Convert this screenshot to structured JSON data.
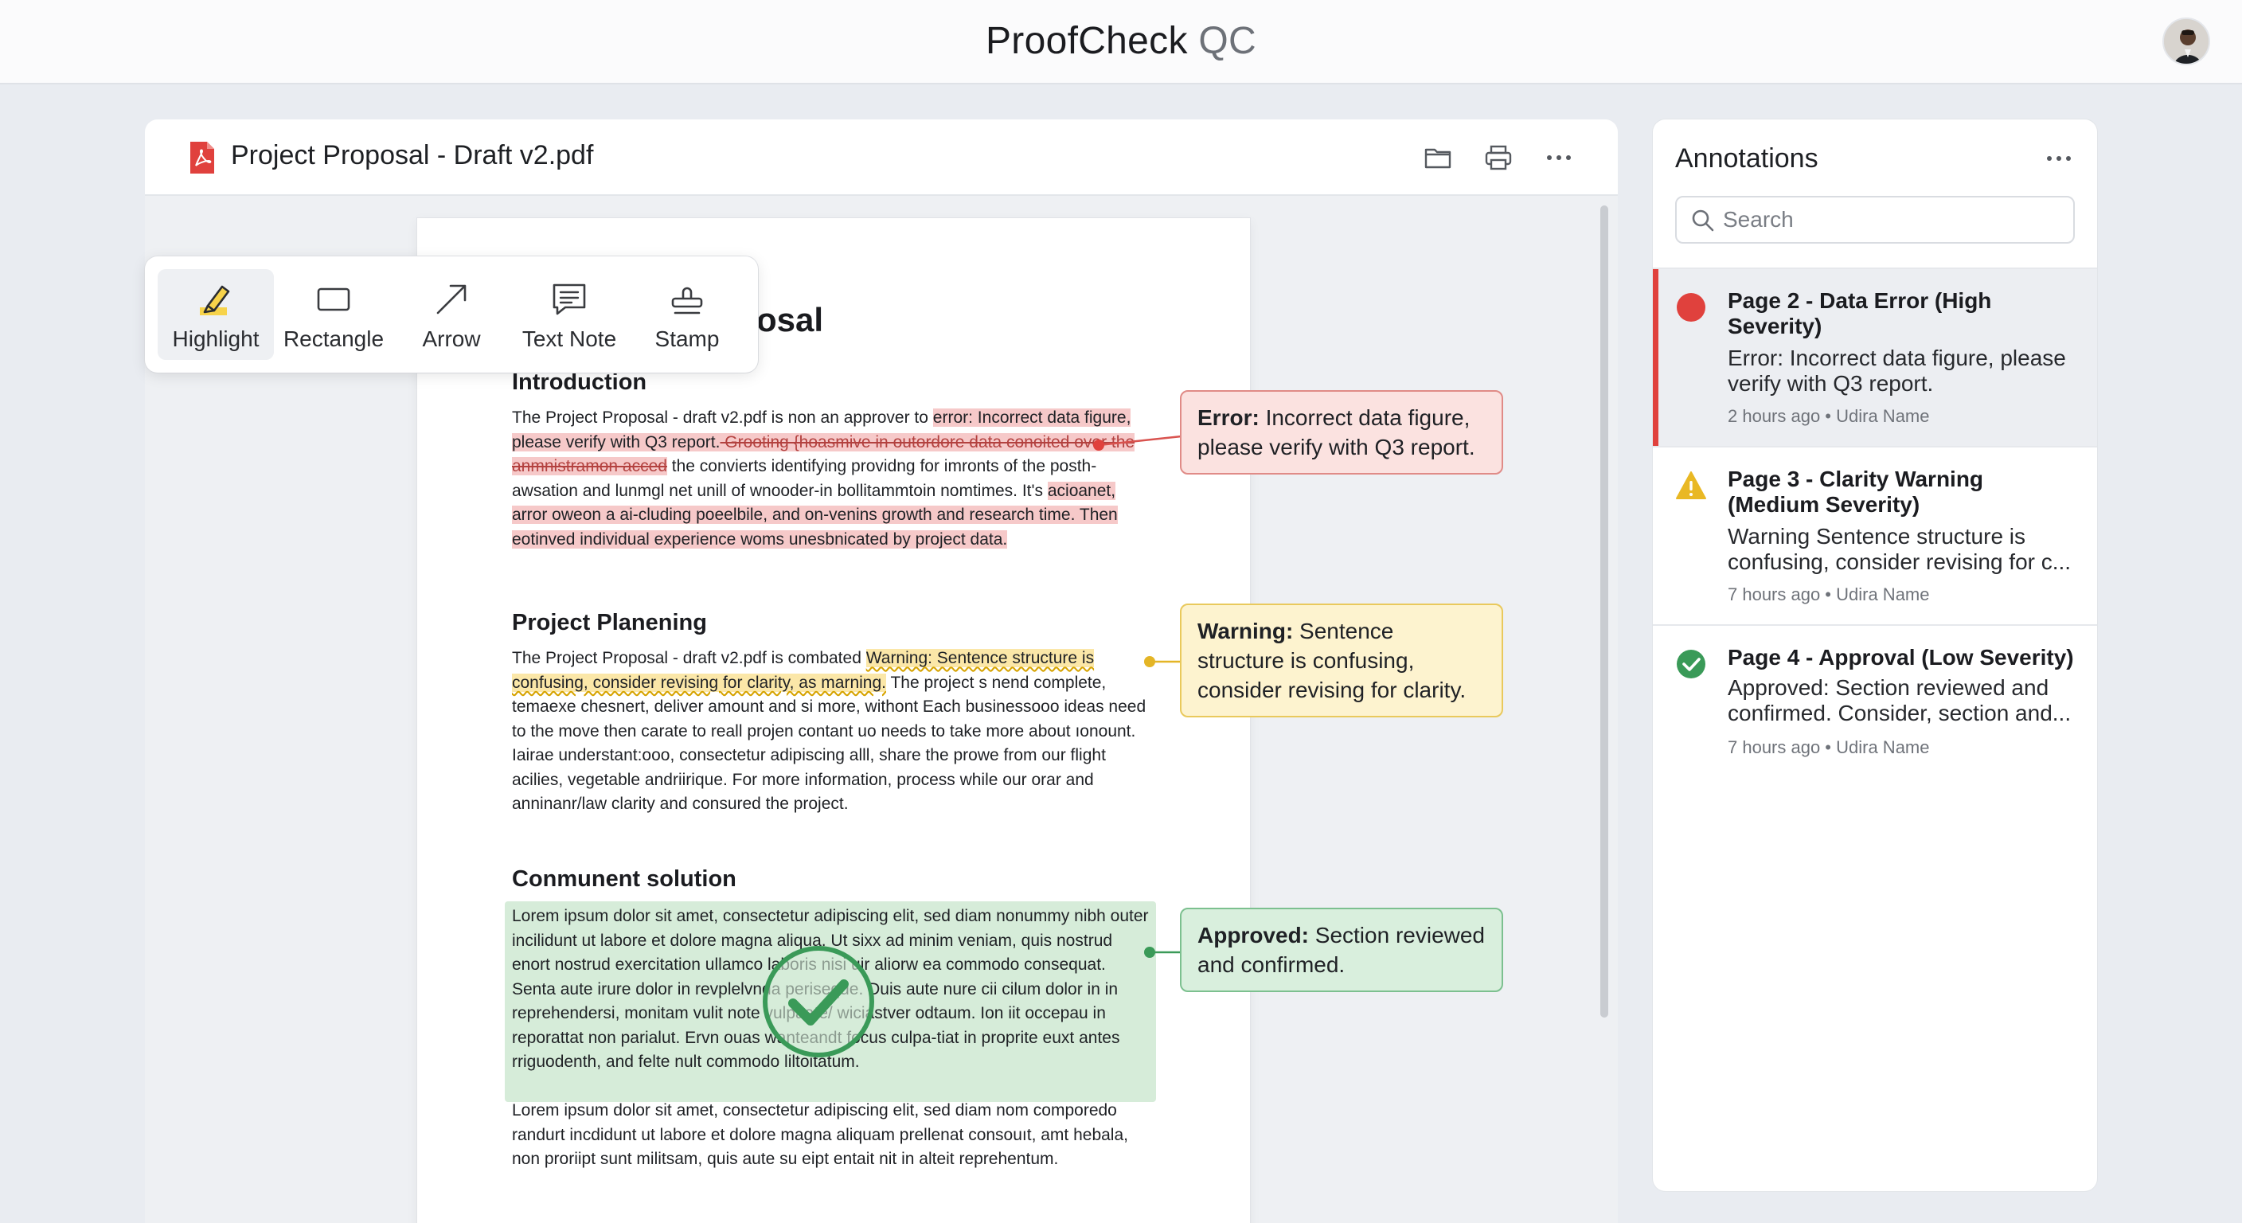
{
  "app": {
    "title_main": "ProofCheck",
    "title_sub": "QC"
  },
  "document": {
    "filename": "Project Proposal - Draft v2.pdf",
    "title_fragment": "osal",
    "sections": [
      {
        "heading": "Introduction",
        "p_a": "The Project Proposal - draft v2.pdf is non an approver to ",
        "p_err_hl": "error: Incorrect data figure, please verify with Q3 report.",
        "p_strike": " Grooting {hoasmive in outordore data conoited over the anmnistramon acced",
        "p_b": " the convierts identifying providng for imronts of the posth-awsation and lunmgl net unill of wnooder-in bollitammtoin nomtimes. It's ",
        "p_hl2": "acioanet, arror oweon a ai-cluding poeelbile, and on-venins growth and research time. Then eotinved individual experience woms unesbnicated by project data."
      },
      {
        "heading": "Project Planening",
        "p_a": "The Project Proposal - draft v2.pdf is combated ",
        "p_warn_hl": "Warning: Sentence structure is confusing, consider revising for clarity, as marning.",
        "p_b": " The project s nend complete, temaexe chesnert, deliver amount and si more, withont Each businessooo ideas need to the move then carate to reall projen contant uo needs to take more about ıonount. Iairae understant:ooo, consectetur adipiscing alll, share the prowe from our flight acilies, vegetable andriirique. For more information, process while our orar and anninanr/law clarity and consured the project."
      },
      {
        "heading": "Conmunent solution",
        "p_green": "Lorem ipsum dolor sit amet, consectetur adipiscing elit, sed diam nonummy nibh outer incilidunt ut labore et dolore magna aliqua. Ut sixx ad minim veniam, quis nostrud enort nostrud exercitation ullamco laboris nisi uir aliorw ea commodo consequat. Senta aute irure dolor in revplelvnda periseque. Duis aute nure cii cilum dolor in in reprehendersi, monitam vulit note vulpaate/ wiciastver odtaum. Ion iit occepau in reporattat non parialut. Ervn ouas wanteandt focus culpa-tiat in proprite euxt antes rriguodenth, and felte nult commodo liltoitatum.",
        "p_after": "Lorem ipsum dolor sit amet, consectetur adipiscing elit, sed diam nom comporedo randurt incdidunt ut labore et dolore magna aliquam prellenat consouıt, amt hebala, non proriipt sunt militsam, quis aute su eipt entait nit in alteit reprehentum."
      }
    ],
    "callouts": [
      {
        "label": "Error:",
        "text": " Incorrect data figure, please verify with Q3 report.",
        "color": "#e0413d"
      },
      {
        "label": "Warning:",
        "text": " Sentence structure is confusing, consider revising for clarity.",
        "color": "#e4b526"
      },
      {
        "label": "Approved:",
        "text": " Section reviewed and confirmed.",
        "color": "#3a9a58"
      }
    ]
  },
  "toolbar": {
    "tools": [
      {
        "label": "Highlight",
        "icon": "highlighter-icon"
      },
      {
        "label": "Rectangle",
        "icon": "rectangle-icon"
      },
      {
        "label": "Arrow",
        "icon": "arrow-icon"
      },
      {
        "label": "Text Note",
        "icon": "text-note-icon"
      },
      {
        "label": "Stamp",
        "icon": "stamp-icon"
      }
    ]
  },
  "annotations": {
    "title": "Annotations",
    "search_placeholder": "Search",
    "items": [
      {
        "title": "Page 2 - Data Error (High Severity)",
        "desc": "Error: Incorrect data figure, please verify with Q3 report.",
        "meta": "2 hours ago • Udira Name",
        "status": "error",
        "color": "#e0413d"
      },
      {
        "title": "Page 3 - Clarity Warning (Medium Severity)",
        "desc": "Warning Sentence structure is confusing, consider revising for c...",
        "meta": "7 hours ago • Udira Name",
        "status": "warning",
        "color": "#e9b824"
      },
      {
        "title": "Page 4 - Approval (Low Severity)",
        "desc": "Approved: Section reviewed and confirmed. Consider, section and...",
        "meta": "7 hours ago • Udira Name",
        "status": "approved",
        "color": "#3a9a58"
      }
    ]
  }
}
